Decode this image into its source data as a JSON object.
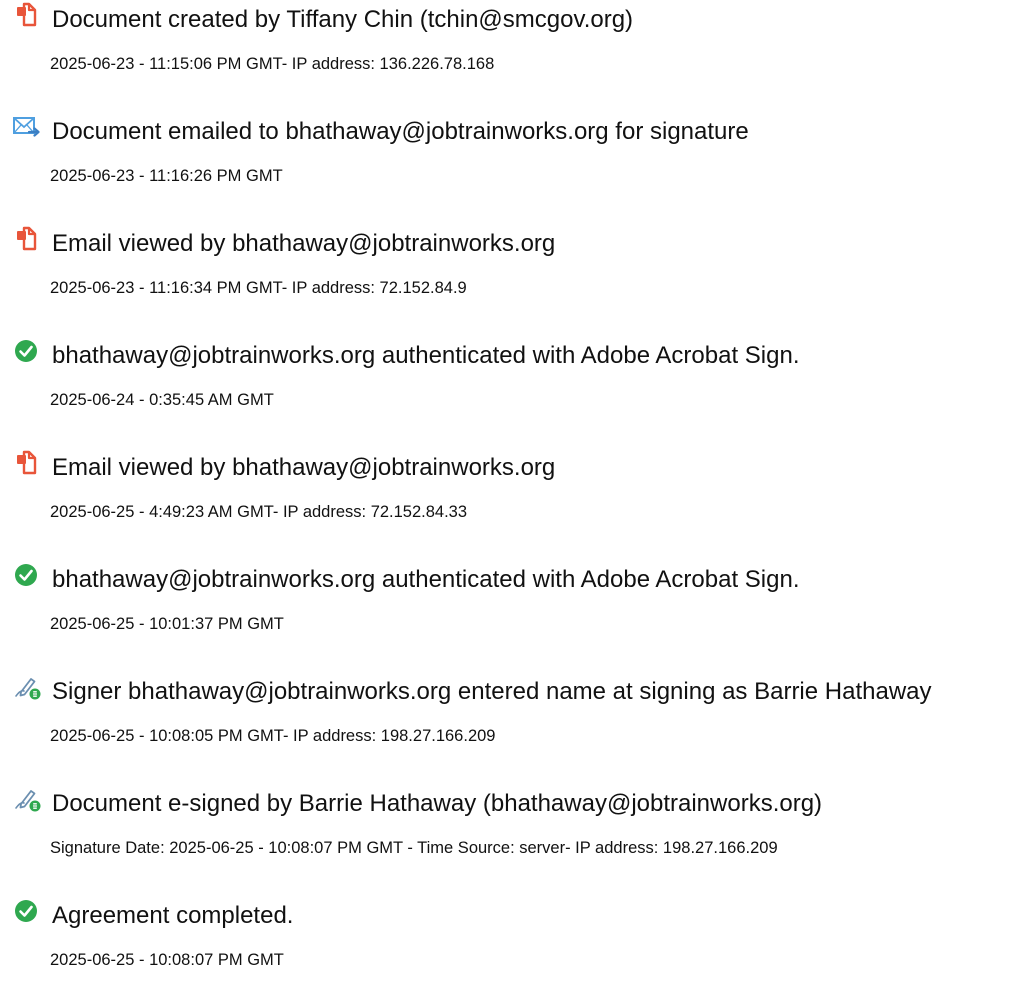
{
  "events": [
    {
      "icon": "document-created-icon",
      "title": "Document created by Tiffany Chin (tchin@smcgov.org)",
      "detail": "2025-06-23 - 11:15:06 PM GMT- IP address: 136.226.78.168"
    },
    {
      "icon": "email-sent-icon",
      "title": "Document emailed to bhathaway@jobtrainworks.org for signature",
      "detail": "2025-06-23 - 11:16:26 PM GMT"
    },
    {
      "icon": "document-viewed-icon",
      "title": "Email viewed by bhathaway@jobtrainworks.org",
      "detail": "2025-06-23 - 11:16:34 PM GMT- IP address: 72.152.84.9"
    },
    {
      "icon": "check-circle-icon",
      "title": "bhathaway@jobtrainworks.org authenticated with Adobe Acrobat Sign.",
      "detail": "2025-06-24 - 0:35:45 AM GMT"
    },
    {
      "icon": "document-viewed-icon",
      "title": "Email viewed by bhathaway@jobtrainworks.org",
      "detail": "2025-06-25 - 4:49:23 AM GMT- IP address: 72.152.84.33"
    },
    {
      "icon": "check-circle-icon",
      "title": "bhathaway@jobtrainworks.org authenticated with Adobe Acrobat Sign.",
      "detail": "2025-06-25 - 10:01:37 PM GMT"
    },
    {
      "icon": "signature-pen-icon",
      "title": "Signer bhathaway@jobtrainworks.org entered name at signing as Barrie Hathaway",
      "detail": "2025-06-25 - 10:08:05 PM GMT- IP address: 198.27.166.209"
    },
    {
      "icon": "signature-pen-icon",
      "title": "Document e-signed by Barrie Hathaway (bhathaway@jobtrainworks.org)",
      "detail": "Signature Date: 2025-06-25 - 10:08:07 PM GMT - Time Source: server- IP address: 198.27.166.209"
    },
    {
      "icon": "check-circle-icon",
      "title": "Agreement completed.",
      "detail": "2025-06-25 - 10:08:07 PM GMT"
    }
  ],
  "colors": {
    "text": "#111111",
    "document_icon": "#e8553a",
    "email_icon": "#4f9fe0",
    "check_icon": "#2fa84f",
    "signature_icon_pen": "#6b8fb0",
    "signature_icon_badge": "#2fa84f"
  }
}
